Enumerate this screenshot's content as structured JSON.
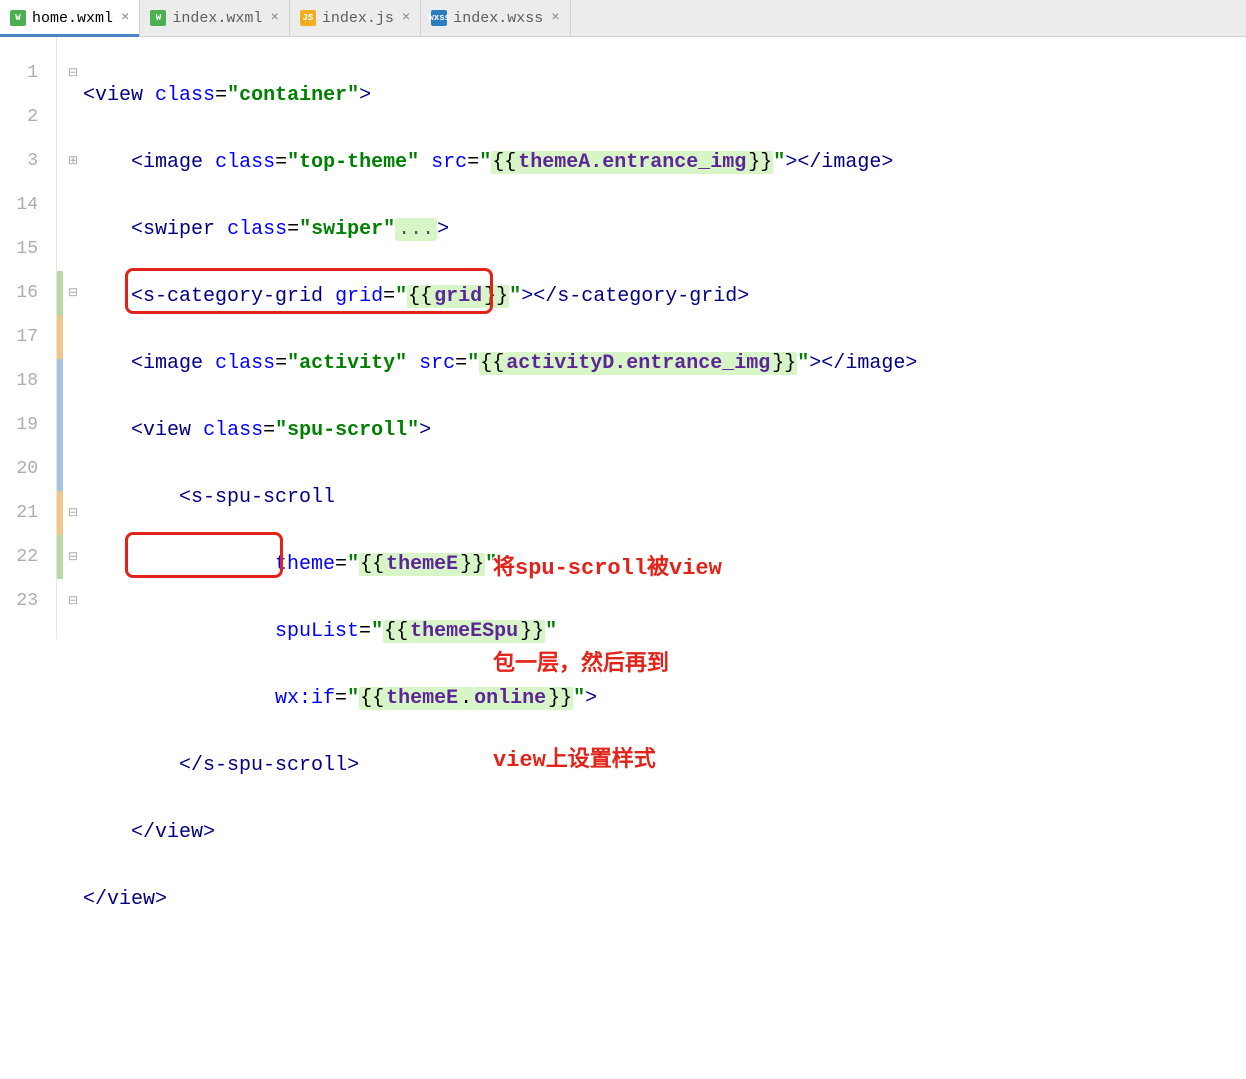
{
  "tabs": [
    {
      "icon": "W",
      "iconClass": "icon-wxml",
      "label": "home.wxml",
      "close": "×",
      "active": true
    },
    {
      "icon": "W",
      "iconClass": "icon-wxml",
      "label": "index.wxml",
      "close": "×",
      "active": false
    },
    {
      "icon": "JS",
      "iconClass": "icon-js",
      "label": "index.js",
      "close": "×",
      "active": false
    },
    {
      "icon": "wxss",
      "iconClass": "icon-wxss",
      "label": "index.wxss",
      "close": "×",
      "active": false
    }
  ],
  "lines": [
    "1",
    "2",
    "3",
    "14",
    "15",
    "16",
    "17",
    "18",
    "19",
    "20",
    "21",
    "22",
    "23"
  ],
  "folds": [
    "⊟",
    "",
    "⊞",
    "",
    "",
    "⊟",
    "",
    "",
    "",
    "",
    "⊟",
    "⊟",
    "⊟"
  ],
  "changes": [
    "",
    "",
    "",
    "",
    "",
    "chg-green",
    "chg-orange",
    "chg-blue",
    "chg-blue",
    "chg-blue",
    "chg-orange",
    "chg-green",
    ""
  ],
  "code": {
    "l1_open": "<",
    "l1_tag": "view",
    "l1_sp": " ",
    "l1_attr": "class",
    "l1_eq": "=",
    "l1_q": "\"",
    "l1_val": "container",
    "l1_close": ">",
    "l2_open": "<",
    "l2_tag": "image",
    "l2_attr1": "class",
    "l2_eq": "=",
    "l2_q": "\"",
    "l2_val1": "top-theme",
    "l2_attr2": "src",
    "l2_bro": "{{",
    "l2_bind": "themeA.entrance_img",
    "l2_brc": "}}",
    "l2_closeo": "></",
    "l2_closet": "image",
    "l2_gt": ">",
    "l3_open": "<",
    "l3_tag": "swiper",
    "l3_attr": "class",
    "l3_val": "swiper",
    "l3_dots": "...",
    "l3_gt": ">",
    "l4_open": "<",
    "l4_tag": "s-category-grid",
    "l4_attr": "grid",
    "l4_bro": "{{",
    "l4_bind": "grid",
    "l4_brc": "}}",
    "l4_closeo": "></",
    "l4_closet": "s-category-grid",
    "l4_gt": ">",
    "l5_open": "<",
    "l5_tag": "image",
    "l5_attr1": "class",
    "l5_val1": "activity",
    "l5_attr2": "src",
    "l5_bro": "{{",
    "l5_bind": "activityD.entrance_img",
    "l5_brc": "}}",
    "l5_closeo": "></",
    "l5_closet": "image",
    "l5_gt": ">",
    "l6_open": "<",
    "l6_tag": "view",
    "l6_attr": "class",
    "l6_val": "spu-scroll",
    "l6_gt": ">",
    "l7_open": "<",
    "l7_tag": "s-spu-scroll",
    "l8_attr": "theme",
    "l8_bro": "{{",
    "l8_bind": "themeE",
    "l8_brc": "}}",
    "l9_attr": "spuList",
    "l9_bro": "{{",
    "l9_bind": "themeESpu",
    "l9_brc": "}}",
    "l10_attr": "wx:if",
    "l10_bro": "{{",
    "l10_bind1": "themeE",
    "l10_dot": ".",
    "l10_bind2": "online",
    "l10_brc": "}}",
    "l10_gt": ">",
    "l11_open": "</",
    "l11_tag": "s-spu-scroll",
    "l11_gt": ">",
    "l12_open": "</",
    "l12_tag": "view",
    "l12_gt": ">",
    "l13_open": "</",
    "l13_tag": "view",
    "l13_gt": ">"
  },
  "annot": {
    "line1": "将spu-scroll被view",
    "line2": "包一层，然后再到",
    "line3": "view上设置样式"
  }
}
